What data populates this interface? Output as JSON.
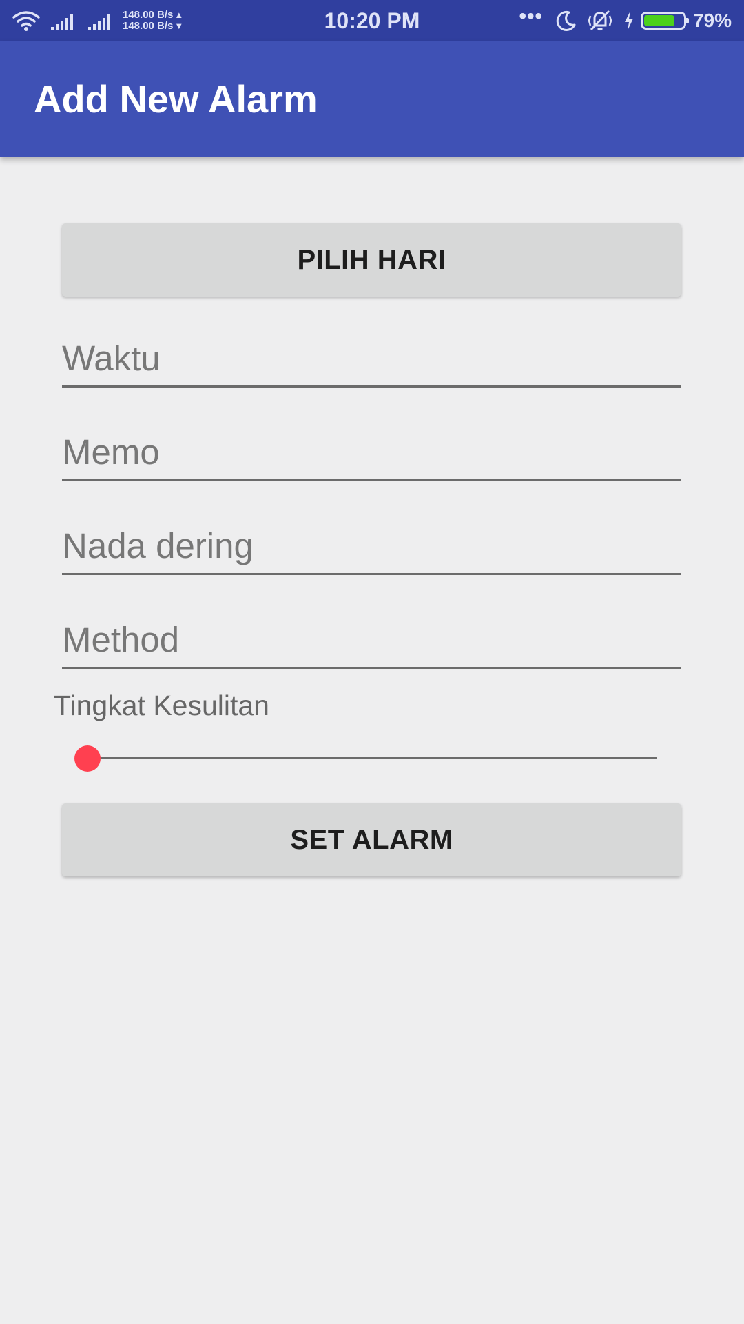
{
  "status_bar": {
    "net_speed_up": "148.00 B/s",
    "net_speed_down": "148.00 B/s",
    "time": "10:20 PM",
    "overflow": "•••",
    "battery_percent_label": "79%",
    "battery_level": 0.79,
    "icons": [
      "wifi-icon",
      "signal-icon",
      "signal-icon",
      "moon-icon",
      "vibrate-off-icon",
      "charging-icon",
      "battery-icon"
    ]
  },
  "app_bar": {
    "title": "Add New Alarm",
    "color": "#3f51b5"
  },
  "form": {
    "pilih_hari_label": "PILIH HARI",
    "waktu_placeholder": "Waktu",
    "memo_placeholder": "Memo",
    "nada_placeholder": "Nada dering",
    "method_placeholder": "Method",
    "difficulty_label": "Tingkat Kesulitan",
    "difficulty_value": 0,
    "set_alarm_label": "SET ALARM"
  },
  "colors": {
    "status_bar": "#303f9f",
    "accent": "#ff4050",
    "background": "#eeeeef",
    "button": "#d7d8d8"
  }
}
